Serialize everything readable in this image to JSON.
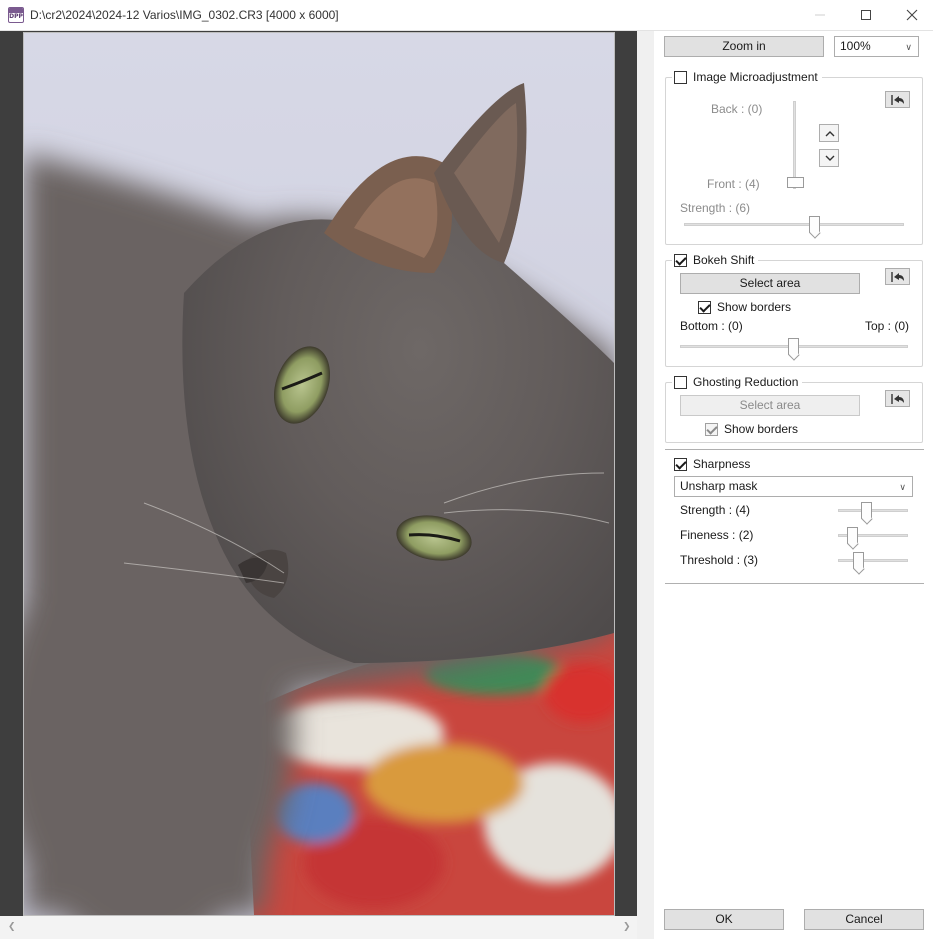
{
  "window": {
    "title": "D:\\cr2\\2024\\2024-12 Varios\\IMG_0302.CR3 [4000 x 6000]",
    "app_icon_text": "DPP"
  },
  "toolbar": {
    "zoom_in_label": "Zoom in",
    "zoom_value": "100%"
  },
  "microadjustment": {
    "enabled": false,
    "title": "Image Microadjustment",
    "back_label": "Back : (0)",
    "front_label": "Front : (4)",
    "strength_label": "Strength : (6)",
    "strength_value": 6
  },
  "bokeh_shift": {
    "enabled": true,
    "title": "Bokeh Shift",
    "select_area_label": "Select area",
    "show_borders_label": "Show borders",
    "show_borders": true,
    "bottom_label": "Bottom : (0)",
    "top_label": "Top : (0)"
  },
  "ghosting_reduction": {
    "enabled": false,
    "title": "Ghosting Reduction",
    "select_area_label": "Select area",
    "show_borders_label": "Show borders",
    "show_borders": true
  },
  "sharpness": {
    "enabled": true,
    "title": "Sharpness",
    "mode": "Unsharp mask",
    "strength_label": "Strength : (4)",
    "strength_value": 4,
    "fineness_label": "Fineness : (2)",
    "fineness_value": 2,
    "threshold_label": "Threshold : (3)",
    "threshold_value": 3
  },
  "footer": {
    "ok_label": "OK",
    "cancel_label": "Cancel"
  },
  "icons": [
    "app-icon",
    "minimize-icon",
    "maximize-icon",
    "close-icon",
    "reset-icon",
    "chevron-up-icon",
    "chevron-down-icon",
    "chevron-left-icon",
    "chevron-right-icon"
  ]
}
